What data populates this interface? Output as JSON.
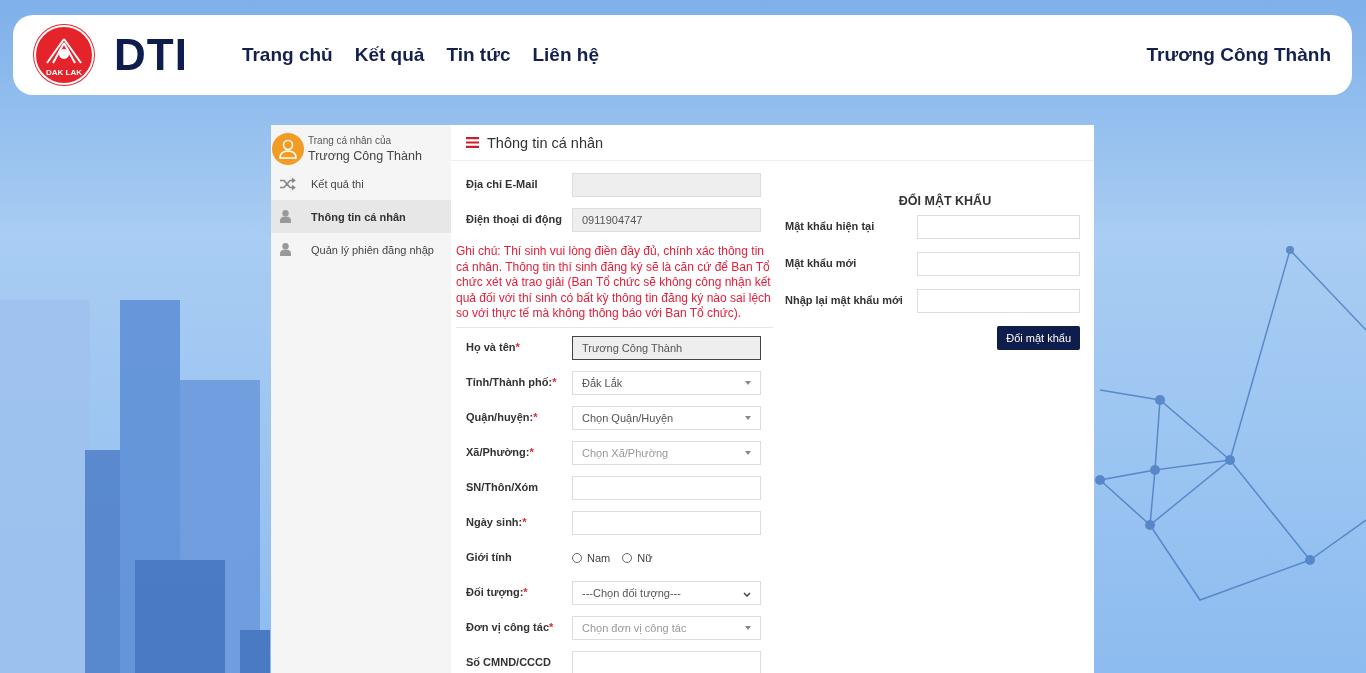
{
  "header": {
    "logo_text": "DAK LAK",
    "brand": "DTI",
    "nav": [
      {
        "label": "Trang chủ"
      },
      {
        "label": "Kết quả"
      },
      {
        "label": "Tin tức"
      },
      {
        "label": "Liên hệ"
      }
    ],
    "user": "Trương Công Thành"
  },
  "sidebar": {
    "profile_caption": "Trang cá nhân của",
    "profile_name": "Trương Công Thành",
    "items": [
      {
        "label": "Kết quả thi",
        "kind": "shuffle",
        "selected": false
      },
      {
        "label": "Thông tin cá nhân",
        "kind": "user",
        "selected": true
      },
      {
        "label": "Quản lý phiên đăng nhập",
        "kind": "user",
        "selected": false
      }
    ]
  },
  "profile": {
    "title": "Thông tin cá nhân",
    "contact_fields": [
      {
        "kind": "text",
        "label": "Địa chỉ E-Mail",
        "disabled": true,
        "focused": false
      },
      {
        "kind": "text",
        "label": "Điện thoại di động",
        "value": "0911904747",
        "disabled": true,
        "focused": false
      }
    ],
    "note": "Ghi chú: Thí sinh vui lòng điền đầy đủ, chính xác thông tin cá nhân. Thông tin thí sinh đăng ký sẽ là căn cứ để Ban Tổ chức xét và trao giải (Ban Tổ chức sẽ không công nhận kết quả đối với thí sinh có bất kỳ thông tin đăng ký nào sai lệch so với thực tế mà không thông báo với Ban Tổ chức).",
    "fields": [
      {
        "kind": "text",
        "label": "Họ và tên",
        "required_mark": "*",
        "value": "Trương Công Thành",
        "disabled": true,
        "focused": true
      },
      {
        "kind": "select",
        "label": "Tỉnh/Thành phố:",
        "required_mark": "*",
        "value": "Đắk Lắk"
      },
      {
        "kind": "select",
        "label": "Quận/huyện:",
        "required_mark": "*",
        "value": "Chọn Quận/Huyện"
      },
      {
        "kind": "select",
        "label": "Xã/Phường:",
        "required_mark": "*",
        "placeholder": "Chọn Xã/Phường"
      },
      {
        "kind": "text",
        "label": "SN/Thôn/Xóm",
        "disabled": false,
        "focused": false
      },
      {
        "kind": "text",
        "label": "Ngày sinh:",
        "required_mark": "*",
        "disabled": false,
        "focused": false
      },
      {
        "kind": "radio",
        "label": "Giới tính",
        "options": [
          {
            "label": "Nam",
            "selected": false
          },
          {
            "label": "Nữ",
            "selected": false
          }
        ]
      },
      {
        "kind": "native-select",
        "label": "Đối tượng:",
        "required_mark": "*",
        "value": "---Chọn đối tượng---"
      },
      {
        "kind": "select",
        "label": "Đơn vị công tác",
        "required_mark": "*",
        "placeholder": "Chọn đơn vị công tác"
      },
      {
        "kind": "text",
        "label": "Số CMND/CCCD",
        "disabled": false,
        "focused": false
      }
    ]
  },
  "password": {
    "title": "ĐỔI MẬT KHẨU",
    "fields": [
      {
        "label": "Mật khẩu hiện tại"
      },
      {
        "label": "Mật khẩu mới"
      },
      {
        "label": "Nhập lại mật khẩu mới"
      }
    ],
    "button": "Đổi mật khẩu"
  }
}
